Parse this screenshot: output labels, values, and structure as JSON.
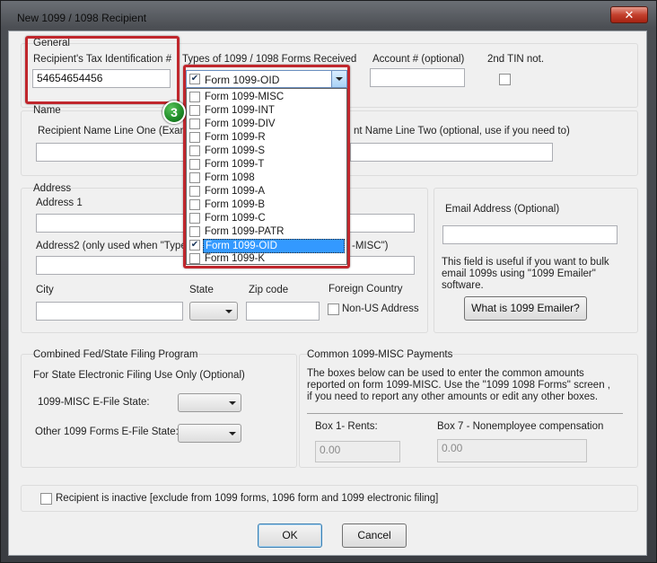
{
  "window": {
    "title": "New 1099 / 1098 Recipient",
    "close_glyph": "✕"
  },
  "general": {
    "group_title": "General",
    "tin_label": "Recipient's Tax Identification #",
    "tin_value": "54654654456",
    "types_label": "Types of 1099 / 1098 Forms Received",
    "types_selected": "Form 1099-OID",
    "account_label": "Account # (optional)",
    "account_value": "",
    "tin_not_label": "2nd TIN not."
  },
  "form_types_list": [
    {
      "label": "Form 1099-MISC",
      "checked": false,
      "selected": false
    },
    {
      "label": "Form 1099-INT",
      "checked": false,
      "selected": false
    },
    {
      "label": "Form 1099-DIV",
      "checked": false,
      "selected": false
    },
    {
      "label": "Form 1099-R",
      "checked": false,
      "selected": false
    },
    {
      "label": "Form 1099-S",
      "checked": false,
      "selected": false
    },
    {
      "label": "Form 1099-T",
      "checked": false,
      "selected": false
    },
    {
      "label": "Form 1098",
      "checked": false,
      "selected": false
    },
    {
      "label": "Form 1099-A",
      "checked": false,
      "selected": false
    },
    {
      "label": "Form 1099-B",
      "checked": false,
      "selected": false
    },
    {
      "label": "Form 1099-C",
      "checked": false,
      "selected": false
    },
    {
      "label": "Form 1099-PATR",
      "checked": false,
      "selected": false
    },
    {
      "label": "Form 1099-OID",
      "checked": true,
      "selected": true
    },
    {
      "label": "Form 1099-K",
      "checked": false,
      "selected": false
    }
  ],
  "name": {
    "group_title": "Name",
    "line_one_label": "Recipient Name Line One (Exampl",
    "line_two_label": "nt Name Line Two (optional, use if you need to)"
  },
  "address": {
    "group_title": "Address",
    "address1_label": "Address 1",
    "address2_label": "Address2 (only used when \"Types",
    "address2_label_tail": "-MISC\")",
    "city_label": "City",
    "state_label": "State",
    "zip_label": "Zip code",
    "foreign_label": "Foreign Country",
    "non_us_label": "Non-US Address"
  },
  "email": {
    "label": "Email Address (Optional)",
    "help_text": "This field is useful if you want to bulk email 1099s using \"1099 Emailer\" software.",
    "button": "What is 1099 Emailer?"
  },
  "state_filing": {
    "group_title": "Combined Fed/State Filing Program",
    "subtitle": "For State Electronic Filing Use Only (Optional)",
    "misc_state_label": "1099-MISC E-File State:",
    "other_state_label": "Other 1099 Forms E-File State:"
  },
  "misc_payments": {
    "group_title": "Common 1099-MISC Payments",
    "description": "The boxes below can be used to enter the common amounts reported on form 1099-MISC. Use the \"1099  1098 Forms\" screen , if you need to report any other amounts or edit any other boxes.",
    "box1_label": "Box 1- Rents:",
    "box1_value": "0.00",
    "box7_label": "Box 7 - Nonemployee compensation",
    "box7_value": "0.00"
  },
  "inactive_label": "Recipient is inactive [exclude from 1099 forms, 1096 form and 1099 electronic filing]",
  "buttons": {
    "ok": "OK",
    "cancel": "Cancel"
  },
  "step_badge": "3",
  "colors": {
    "highlight": "#c0272d",
    "selection": "#3399ff",
    "badge": "#1e8a27"
  }
}
